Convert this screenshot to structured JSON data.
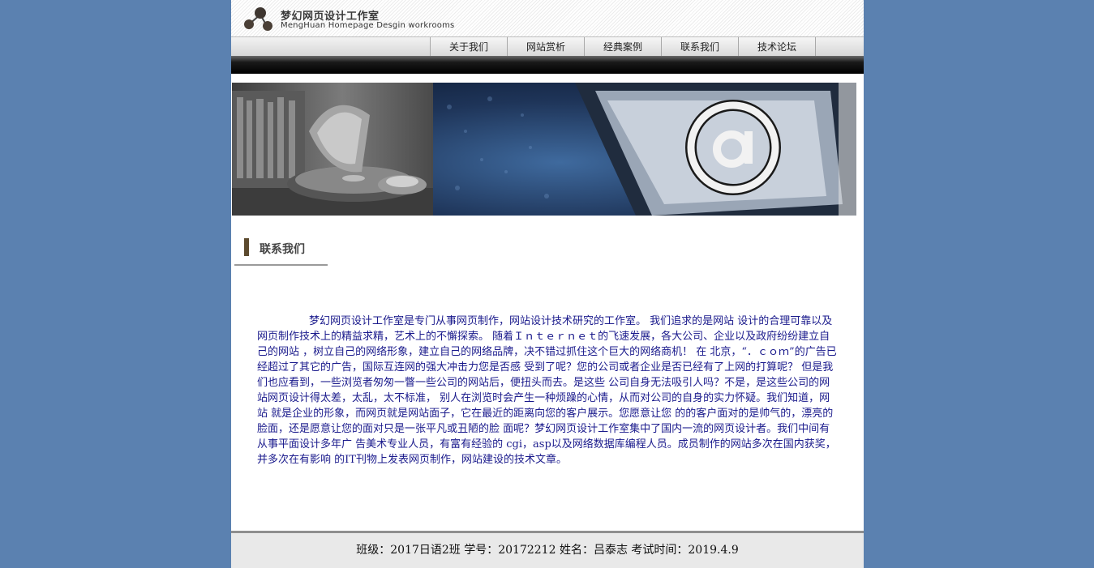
{
  "header": {
    "logo_title": "梦幻网页设计工作室",
    "logo_subtitle": "MengHuan Homepage Desgin workrooms"
  },
  "nav": {
    "items": [
      {
        "label": "关于我们"
      },
      {
        "label": "网站赏析"
      },
      {
        "label": "经典案例"
      },
      {
        "label": "联系我们"
      },
      {
        "label": "技术论坛"
      }
    ]
  },
  "section": {
    "title": "联系我们"
  },
  "content": {
    "paragraph": "梦幻网页设计工作室是专门从事网页制作，网站设计技术研究的工作室。 我们追求的是网站 设计的合理可靠以及网页制作技术上的精益求精，艺术上的不懈探索。     随着Ｉｎｔｅｒｎｅｔ的飞速发展，各大公司、企业以及政府纷纷建立自己的网站 ，树立自己的网络形象，建立自己的网络品牌，决不错过抓住这个巨大的网络商机！ 在 北京，“．ｃｏｍ”的广告已经超过了其它的广告，国际互连网的强大冲击力您是否感 受到了呢？您的公司或者企业是否已经有了上网的打算呢？     但是我们也应看到，一些浏览者匆匆一瞥一些公司的网站后，便扭头而去。是这些 公司自身无法吸引人吗？不是，是这些公司的网站网页设计得太差，太乱，太不标准， 别人在浏览时会产生一种烦躁的心情，从而对公司的自身的实力怀疑。我们知道，网站 就是企业的形象，而网页就是网站面子，它在最近的距离向您的客户展示。您愿意让您 的的客户面对的是帅气的，漂亮的脸面，还是愿意让您的面对只是一张平凡或丑陋的脸 面呢？梦幻网页设计工作室集中了国内一流的网页设计者。我们中间有从事平面设计多年广 告美术专业人员，有富有经验的 cgi，asp以及网络数据库编程人员。成员制作的网站多次在国内获奖，并多次在有影响 的IT刊物上发表网页制作，网站建设的技术文章。"
  },
  "footer": {
    "text": "班级：2017日语2班 学号：20172212 姓名：吕泰志 考试时间：2019.4.9"
  },
  "colors": {
    "background": "#5b81b0",
    "content_text": "#1a1a8c",
    "section_bar": "#5c4a2e"
  }
}
